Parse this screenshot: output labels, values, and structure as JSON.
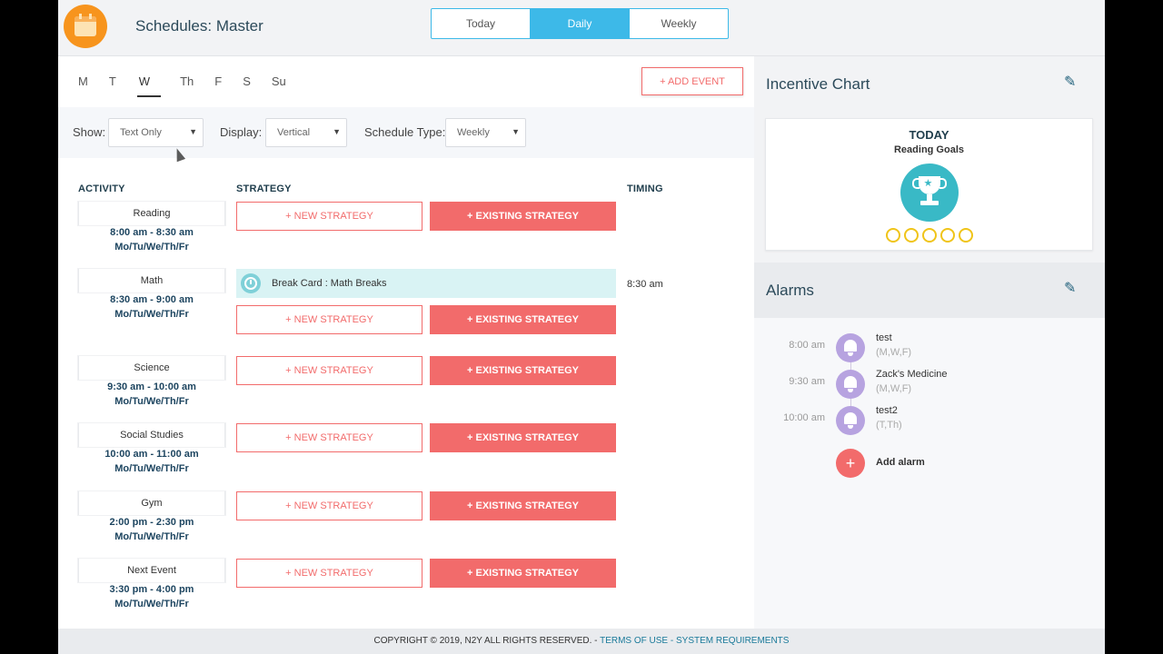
{
  "header": {
    "title": "Schedules: Master",
    "view_tabs": [
      {
        "label": "Today",
        "active": false
      },
      {
        "label": "Daily",
        "active": true
      },
      {
        "label": "Weekly",
        "active": false
      }
    ]
  },
  "days": [
    "M",
    "T",
    "W",
    "Th",
    "F",
    "S",
    "Su"
  ],
  "active_day": "W",
  "add_event_label": "+ ADD EVENT",
  "filters": {
    "show_label": "Show:",
    "show_value": "Text Only",
    "display_label": "Display:",
    "display_value": "Vertical",
    "type_label": "Schedule Type:",
    "type_value": "Weekly"
  },
  "columns": {
    "activity": "ACTIVITY",
    "strategy": "STRATEGY",
    "timing": "TIMING"
  },
  "strategy_buttons": {
    "new": "+ NEW STRATEGY",
    "existing": "+ EXISTING STRATEGY"
  },
  "activities": [
    {
      "name": "Reading",
      "time": "8:00 am - 8:30 am",
      "days": "Mo/Tu/We/Th/Fr"
    },
    {
      "name": "Math",
      "time": "8:30 am - 9:00 am",
      "days": "Mo/Tu/We/Th/Fr"
    },
    {
      "name": "Science",
      "time": "9:30 am - 10:00 am",
      "days": "Mo/Tu/We/Th/Fr"
    },
    {
      "name": "Social Studies",
      "time": "10:00 am - 11:00 am",
      "days": "Mo/Tu/We/Th/Fr"
    },
    {
      "name": "Gym",
      "time": "2:00 pm - 2:30 pm",
      "days": "Mo/Tu/We/Th/Fr"
    },
    {
      "name": "Next Event",
      "time": "3:30 pm - 4:00 pm",
      "days": "Mo/Tu/We/Th/Fr"
    }
  ],
  "break_card": {
    "label": "Break Card : Math Breaks",
    "timing": "8:30 am",
    "icon": "clock-icon"
  },
  "incentive": {
    "title": "Incentive Chart",
    "today": "TODAY",
    "goal": "Reading Goals",
    "icon": "trophy-icon",
    "stars_earned": 0,
    "stars_total": 5
  },
  "alarms": {
    "title": "Alarms",
    "items": [
      {
        "time": "8:00 am",
        "name": "test",
        "days": "(M,W,F)"
      },
      {
        "time": "9:30 am",
        "name": "Zack's Medicine",
        "days": "(M,W,F)"
      },
      {
        "time": "10:00 am",
        "name": "test2",
        "days": "(T,Th)"
      }
    ],
    "add_label": "Add alarm"
  },
  "footer": {
    "copyright": "COPYRIGHT © 2019, N2Y ALL RIGHTS RESERVED. - ",
    "terms": "TERMS OF USE",
    "sep": " - ",
    "sysreq": "SYSTEM REQUIREMENTS"
  },
  "colors": {
    "accent_blue": "#3db9e8",
    "coral": "#f26b6b",
    "teal": "#39b9c6",
    "navy": "#1f3d4c",
    "lavender": "#b7a3e0",
    "orange": "#f7941d"
  }
}
